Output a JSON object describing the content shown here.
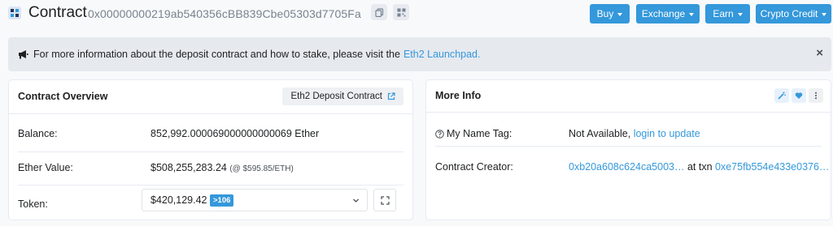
{
  "header": {
    "title": "Contract",
    "address": "0x00000000219ab540356cBB839Cbe05303d7705Fa",
    "copy_icon": "copy-icon",
    "qr_icon": "qr-code-icon",
    "nav": [
      {
        "label": "Buy"
      },
      {
        "label": "Exchange"
      },
      {
        "label": "Earn"
      },
      {
        "label": "Crypto Credit"
      }
    ],
    "accent_color": "#3498db"
  },
  "alert": {
    "icon": "megaphone-icon",
    "text": "For more information about the deposit contract and how to stake, please visit the",
    "link": "Eth2 Launchpad.",
    "close": "×"
  },
  "overview": {
    "title": "Contract Overview",
    "tag_label": "Eth2 Deposit Contract",
    "rows": {
      "balance_label": "Balance:",
      "balance_value": "852,992.000069000000000069 Ether",
      "ether_value_label": "Ether Value:",
      "ether_value": "$508,255,283.24",
      "ether_price": "(@ $595.85/ETH)",
      "token_label": "Token:",
      "token_value": "$420,129.42",
      "token_badge": ">106"
    }
  },
  "more_info": {
    "title": "More Info",
    "name_tag_label": "My Name Tag:",
    "name_tag_value": "Not Available,",
    "name_tag_link": "login to update",
    "creator_label": "Contract Creator:",
    "creator_address": "0xb20a608c624ca5003…",
    "creator_at": "at txn",
    "creator_txn": "0xe75fb554e433e0376…"
  }
}
